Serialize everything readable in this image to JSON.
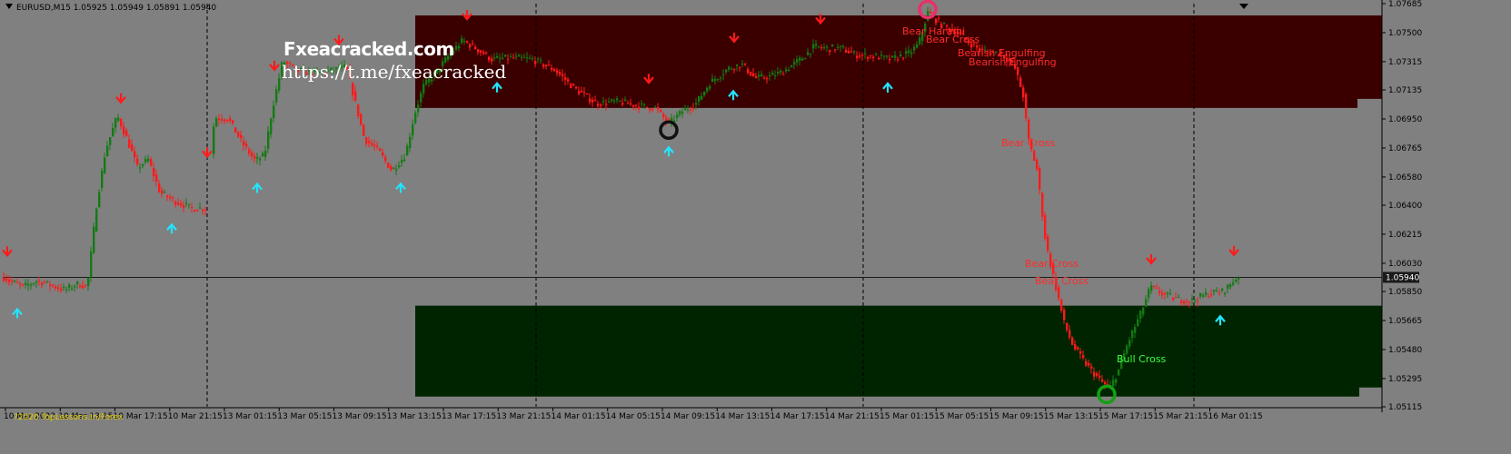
{
  "header": {
    "symbol_info": "EURUSD,M15 1.05925 1.05949 1.05891 1.05940"
  },
  "watermark": {
    "site": "Fxeacracked.com",
    "telegram": "https://t.me/fxeacracked"
  },
  "copyright": "?2020 TopLessons.In/Forex",
  "current_price_label": "1.05940",
  "colors": {
    "background": "#808080",
    "supply_zone": "#3a0000",
    "demand_zone": "#002400",
    "bull_candle": "#137a13",
    "bear_candle": "#ff1a1a",
    "up_arrow": "#22e4ff",
    "down_arrow": "#ff1a1a"
  },
  "pattern_labels": [
    {
      "text": "Bear Harami",
      "type": "bear"
    },
    {
      "text": "Bear Cross",
      "type": "bear"
    },
    {
      "text": "Bearish Engulfing",
      "type": "bear"
    },
    {
      "text": "Bearish Engulfing",
      "type": "bear"
    },
    {
      "text": "Bear Cross",
      "type": "bear"
    },
    {
      "text": "Bear Cross",
      "type": "bear"
    },
    {
      "text": "Bear Cross",
      "type": "bear"
    },
    {
      "text": "Bull Cross",
      "type": "bull"
    }
  ],
  "chart_data": {
    "type": "candlestick",
    "price_axis_ticks": [
      "1.07685",
      "1.07500",
      "1.07315",
      "1.07135",
      "1.06950",
      "1.06765",
      "1.06580",
      "1.06400",
      "1.06215",
      "1.06030",
      "1.05850",
      "1.05665",
      "1.05480",
      "1.05295",
      "1.05115"
    ],
    "time_axis_ticks": [
      "10 Mar 2023",
      "10 Mar 13:15",
      "10 Mar 17:15",
      "10 Mar 21:15",
      "13 Mar 01:15",
      "13 Mar 05:15",
      "13 Mar 09:15",
      "13 Mar 13:15",
      "13 Mar 17:15",
      "13 Mar 21:15",
      "14 Mar 01:15",
      "14 Mar 05:15",
      "14 Mar 09:15",
      "14 Mar 13:15",
      "14 Mar 17:15",
      "14 Mar 21:15",
      "15 Mar 01:15",
      "15 Mar 05:15",
      "15 Mar 09:15",
      "15 Mar 13:15",
      "15 Mar 17:15",
      "15 Mar 21:15",
      "16 Mar 01:15"
    ],
    "ylim": [
      1.05115,
      1.07685
    ],
    "current_price": 1.0594,
    "zones": [
      {
        "name": "supply-zone",
        "low": 1.0702,
        "high": 1.0761
      },
      {
        "name": "demand-zone",
        "low": 1.0518,
        "high": 1.0576
      }
    ],
    "close_path": [
      [
        0,
        1.0595
      ],
      [
        12,
        1.0591
      ],
      [
        25,
        1.0588
      ],
      [
        40,
        1.0592
      ],
      [
        55,
        1.0589
      ],
      [
        70,
        1.0586
      ],
      [
        85,
        1.059
      ],
      [
        95,
        1.0588
      ],
      [
        105,
        1.064
      ],
      [
        115,
        1.0675
      ],
      [
        128,
        1.0697
      ],
      [
        140,
        1.068
      ],
      [
        150,
        1.0664
      ],
      [
        162,
        1.0669
      ],
      [
        175,
        1.0648
      ],
      [
        190,
        1.0643
      ],
      [
        210,
        1.0638
      ],
      [
        225,
        1.0638
      ],
      [
        235,
        1.0696
      ],
      [
        250,
        1.0695
      ],
      [
        265,
        1.068
      ],
      [
        280,
        1.0668
      ],
      [
        290,
        1.0672
      ],
      [
        298,
        1.07
      ],
      [
        310,
        1.0732
      ],
      [
        325,
        1.0726
      ],
      [
        345,
        1.0724
      ],
      [
        365,
        1.0726
      ],
      [
        380,
        1.0728
      ],
      [
        390,
        1.0705
      ],
      [
        400,
        1.0682
      ],
      [
        415,
        1.0675
      ],
      [
        430,
        1.0662
      ],
      [
        445,
        1.0672
      ],
      [
        455,
        1.0698
      ],
      [
        465,
        1.0716
      ],
      [
        478,
        1.0724
      ],
      [
        492,
        1.0735
      ],
      [
        508,
        1.0745
      ],
      [
        520,
        1.0741
      ],
      [
        540,
        1.0733
      ],
      [
        560,
        1.0734
      ],
      [
        585,
        1.0733
      ],
      [
        610,
        1.0726
      ],
      [
        630,
        1.0715
      ],
      [
        655,
        1.0705
      ],
      [
        680,
        1.0706
      ],
      [
        705,
        1.0703
      ],
      [
        720,
        1.0702
      ],
      [
        735,
        1.0692
      ],
      [
        750,
        1.07
      ],
      [
        765,
        1.0705
      ],
      [
        780,
        1.0718
      ],
      [
        800,
        1.0727
      ],
      [
        815,
        1.073
      ],
      [
        830,
        1.0721
      ],
      [
        845,
        1.0722
      ],
      [
        860,
        1.0725
      ],
      [
        880,
        1.0733
      ],
      [
        895,
        1.0741
      ],
      [
        910,
        1.074
      ],
      [
        925,
        1.074
      ],
      [
        940,
        1.0736
      ],
      [
        960,
        1.0735
      ],
      [
        980,
        1.0733
      ],
      [
        1000,
        1.0737
      ],
      [
        1010,
        1.0743
      ],
      [
        1020,
        1.0763
      ],
      [
        1035,
        1.0755
      ],
      [
        1050,
        1.0751
      ],
      [
        1065,
        1.0744
      ],
      [
        1080,
        1.0738
      ],
      [
        1100,
        1.0737
      ],
      [
        1115,
        1.0729
      ],
      [
        1125,
        1.071
      ],
      [
        1130,
        1.0683
      ],
      [
        1140,
        1.0663
      ],
      [
        1150,
        1.0615
      ],
      [
        1160,
        1.059
      ],
      [
        1170,
        1.0565
      ],
      [
        1180,
        1.055
      ],
      [
        1195,
        1.0538
      ],
      [
        1210,
        1.0528
      ],
      [
        1220,
        1.0523
      ],
      [
        1230,
        1.0535
      ],
      [
        1240,
        1.0552
      ],
      [
        1255,
        1.0572
      ],
      [
        1265,
        1.0588
      ],
      [
        1280,
        1.0583
      ],
      [
        1295,
        1.058
      ],
      [
        1310,
        1.0579
      ],
      [
        1330,
        1.0584
      ],
      [
        1345,
        1.0585
      ],
      [
        1362,
        1.0595
      ]
    ],
    "signals": [
      {
        "type": "sell",
        "x": 8
      },
      {
        "type": "buy",
        "x": 19
      },
      {
        "type": "sell",
        "x": 133
      },
      {
        "type": "buy",
        "x": 189
      },
      {
        "type": "sell",
        "x": 228
      },
      {
        "type": "buy",
        "x": 283
      },
      {
        "type": "sell",
        "x": 302
      },
      {
        "type": "sell",
        "x": 373
      },
      {
        "type": "buy",
        "x": 441
      },
      {
        "type": "sell",
        "x": 514
      },
      {
        "type": "buy",
        "x": 547
      },
      {
        "type": "sell",
        "x": 714
      },
      {
        "type": "buy",
        "x": 736
      },
      {
        "type": "buy",
        "x": 807
      },
      {
        "type": "sell",
        "x": 808
      },
      {
        "type": "sell",
        "x": 903
      },
      {
        "type": "buy",
        "x": 977
      },
      {
        "type": "sell",
        "x": 1267
      },
      {
        "type": "buy",
        "x": 1343
      },
      {
        "type": "sell",
        "x": 1358
      }
    ],
    "circled_swings": [
      {
        "x": 736,
        "kind": "low",
        "ring": "#111111"
      },
      {
        "x": 1021,
        "kind": "high",
        "ring": "#e8306a"
      },
      {
        "x": 1218,
        "kind": "low",
        "ring": "#13a013"
      }
    ]
  }
}
